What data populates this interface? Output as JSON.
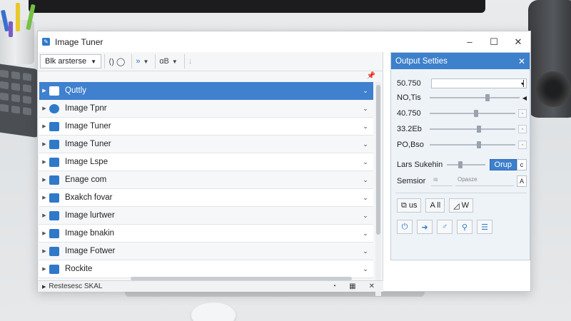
{
  "window": {
    "title": "Image Tuner",
    "controls": [
      "–",
      "☐",
      "✕"
    ]
  },
  "toolbar": {
    "select_label": "Blk arsterse",
    "group1": "⟨) ◯",
    "group2": "»",
    "group3": "ɑB"
  },
  "list": {
    "items": [
      {
        "label": "Quttly",
        "icon": "grid-icon",
        "selected": true
      },
      {
        "label": "Image Tpnr",
        "icon": "compass-icon",
        "selected": false
      },
      {
        "label": "Image Tuner",
        "icon": "image-icon",
        "selected": false
      },
      {
        "label": "Image Tuner",
        "icon": "monitor-icon",
        "selected": false
      },
      {
        "label": "Image Lspe",
        "icon": "square-icon",
        "selected": false
      },
      {
        "label": "Enage com",
        "icon": "chat-icon",
        "selected": false
      },
      {
        "label": "Bxakch fovar",
        "icon": "display-icon",
        "selected": false
      },
      {
        "label": "Image lurtwer",
        "icon": "pen-icon",
        "selected": false
      },
      {
        "label": "Image bnakin",
        "icon": "picture-icon",
        "selected": false
      },
      {
        "label": "Image Fotwer",
        "icon": "list-icon",
        "selected": false
      },
      {
        "label": "Rockite",
        "icon": "gear-icon",
        "selected": false
      }
    ]
  },
  "statusbar": {
    "text": "Restesesc  SKAL"
  },
  "output_panel": {
    "title": "Output Setties",
    "params": [
      {
        "label": "50.750"
      },
      {
        "label": "NO,Tis",
        "level": 0.62
      },
      {
        "label": "40.750",
        "level": 0.52
      },
      {
        "label": "33.2Eb",
        "level": 0.55
      },
      {
        "label": "PO,Bso",
        "level": 0.55
      }
    ],
    "lars": {
      "label": "Lars Sukehin",
      "button": "Orup",
      "level": 0.3
    },
    "sensor": {
      "label": "Semsior",
      "value": "ıs",
      "placeholder": "Opasze"
    },
    "buttons_row1": [
      "us",
      "A ll",
      "W"
    ],
    "buttons_row2": [
      "⏻",
      "➜",
      "♂",
      "⚲",
      "☰"
    ]
  }
}
